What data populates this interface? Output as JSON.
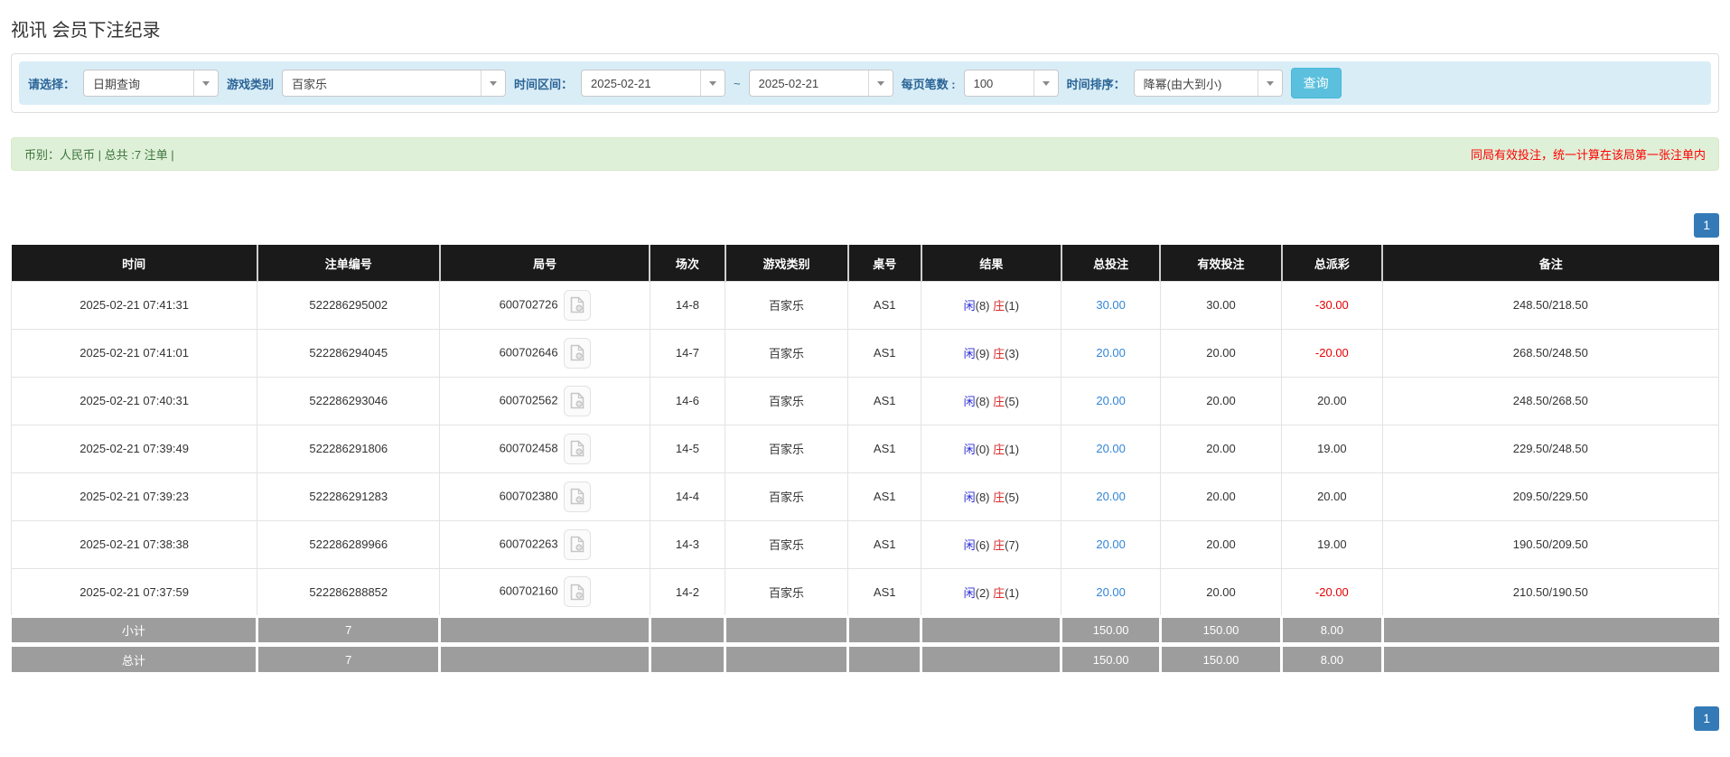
{
  "page": {
    "title": "视讯 会员下注纪录"
  },
  "filters": {
    "select_label": "请选择：",
    "select_value": "日期查询",
    "game_label": "游戏类别",
    "game_value": "百家乐",
    "range_label": "时间区间：",
    "range_start": "2025-02-21",
    "range_sep": "~",
    "range_end": "2025-02-21",
    "per_page_label": "每页笔数 :",
    "per_page_value": "100",
    "sort_label": "时间排序：",
    "sort_value": "降幂(由大到小)",
    "search_button": "查询"
  },
  "summary": {
    "left": "币别：人民币 | 总共 :7 注单 |",
    "right": "同局有效投注，统一计算在该局第一张注单内"
  },
  "pagination": {
    "page": "1"
  },
  "table": {
    "headers": [
      "时间",
      "注单编号",
      "局号",
      "场次",
      "游戏类别",
      "桌号",
      "结果",
      "总投注",
      "有效投注",
      "总派彩",
      "备注"
    ],
    "col_widths_pct": [
      14.4,
      10.7,
      12.3,
      4.4,
      7.2,
      4.3,
      8.2,
      5.8,
      7.1,
      5.9,
      19.7
    ],
    "rows": [
      {
        "time": "2025-02-21 07:41:31",
        "bet_id": "522286295002",
        "round_id": "600702726",
        "session": "14-8",
        "game": "百家乐",
        "table_no": "AS1",
        "result_player": "闲(8)",
        "result_banker": "庄(1)",
        "total_bet": "30.00",
        "valid_bet": "30.00",
        "payout": "-30.00",
        "remark": "248.50/218.50"
      },
      {
        "time": "2025-02-21 07:41:01",
        "bet_id": "522286294045",
        "round_id": "600702646",
        "session": "14-7",
        "game": "百家乐",
        "table_no": "AS1",
        "result_player": "闲(9)",
        "result_banker": "庄(3)",
        "total_bet": "20.00",
        "valid_bet": "20.00",
        "payout": "-20.00",
        "remark": "268.50/248.50"
      },
      {
        "time": "2025-02-21 07:40:31",
        "bet_id": "522286293046",
        "round_id": "600702562",
        "session": "14-6",
        "game": "百家乐",
        "table_no": "AS1",
        "result_player": "闲(8)",
        "result_banker": "庄(5)",
        "total_bet": "20.00",
        "valid_bet": "20.00",
        "payout": "20.00",
        "remark": "248.50/268.50"
      },
      {
        "time": "2025-02-21 07:39:49",
        "bet_id": "522286291806",
        "round_id": "600702458",
        "session": "14-5",
        "game": "百家乐",
        "table_no": "AS1",
        "result_player": "闲(0)",
        "result_banker": "庄(1)",
        "total_bet": "20.00",
        "valid_bet": "20.00",
        "payout": "19.00",
        "remark": "229.50/248.50"
      },
      {
        "time": "2025-02-21 07:39:23",
        "bet_id": "522286291283",
        "round_id": "600702380",
        "session": "14-4",
        "game": "百家乐",
        "table_no": "AS1",
        "result_player": "闲(8)",
        "result_banker": "庄(5)",
        "total_bet": "20.00",
        "valid_bet": "20.00",
        "payout": "20.00",
        "remark": "209.50/229.50"
      },
      {
        "time": "2025-02-21 07:38:38",
        "bet_id": "522286289966",
        "round_id": "600702263",
        "session": "14-3",
        "game": "百家乐",
        "table_no": "AS1",
        "result_player": "闲(6)",
        "result_banker": "庄(7)",
        "total_bet": "20.00",
        "valid_bet": "20.00",
        "payout": "19.00",
        "remark": "190.50/209.50"
      },
      {
        "time": "2025-02-21 07:37:59",
        "bet_id": "522286288852",
        "round_id": "600702160",
        "session": "14-2",
        "game": "百家乐",
        "table_no": "AS1",
        "result_player": "闲(2)",
        "result_banker": "庄(1)",
        "total_bet": "20.00",
        "valid_bet": "20.00",
        "payout": "-20.00",
        "remark": "210.50/190.50"
      }
    ],
    "subtotal": {
      "label": "小计",
      "count": "7",
      "total_bet": "150.00",
      "valid_bet": "150.00",
      "payout": "8.00"
    },
    "total": {
      "label": "总计",
      "count": "7",
      "total_bet": "150.00",
      "valid_bet": "150.00",
      "payout": "8.00"
    }
  },
  "colors": {
    "filter_bar_bg": "#d9edf7",
    "filter_label_blue": "#2a6496",
    "query_button_bg": "#5bc0de",
    "summary_bar_bg": "#dff0d8",
    "summary_text_green": "#3c763d",
    "notice_red": "#ff0000",
    "pagination_blue": "#337ab7",
    "table_header_bg": "#1a1a1a",
    "sum_row_bg": "#9d9d9d",
    "bet_link_blue": "#3385d6",
    "player_blue": "#2b2bd5",
    "banker_red": "#d92b2b",
    "negative_red": "#e60000"
  }
}
